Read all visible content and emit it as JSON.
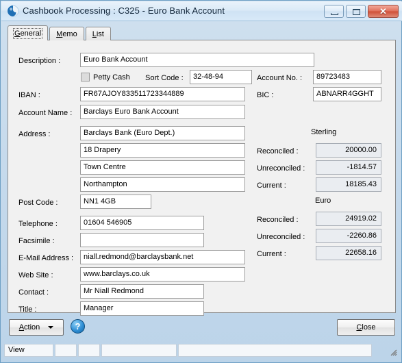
{
  "window": {
    "title": "Cashbook Processing : C325 - Euro Bank Account",
    "icon": "globe-icon",
    "controls": {
      "minimize": "minimize-icon",
      "maximize": "maximize-icon",
      "close": "✕"
    }
  },
  "tabs": [
    {
      "label": "General",
      "mnemonic": "G",
      "active": true
    },
    {
      "label": "Memo",
      "mnemonic": "M",
      "active": false
    },
    {
      "label": "List",
      "mnemonic": "L",
      "active": false
    }
  ],
  "form": {
    "description": {
      "label": "Description :",
      "value": "Euro Bank Account"
    },
    "petty_cash": {
      "label": "Petty Cash",
      "checked": false
    },
    "sort_code": {
      "label": "Sort Code :",
      "value": "32-48-94"
    },
    "account_no": {
      "label": "Account No. :",
      "value": "89723483"
    },
    "iban": {
      "label": "IBAN :",
      "value": "FR67AJOY833511723344889"
    },
    "bic": {
      "label": "BIC :",
      "value": "ABNARR4GGHT"
    },
    "account_name": {
      "label": "Account Name :",
      "value": "Barclays Euro Bank Account"
    },
    "address": {
      "label": "Address :",
      "lines": [
        "Barclays Bank (Euro Dept.)",
        "18 Drapery",
        "Town Centre",
        "Northampton"
      ]
    },
    "post_code": {
      "label": "Post Code :",
      "value": "NN1 4GB"
    },
    "telephone": {
      "label": "Telephone :",
      "value": "01604 546905"
    },
    "facsimile": {
      "label": "Facsimile :",
      "value": ""
    },
    "email": {
      "label": "E-Mail Address :",
      "value": "niall.redmond@barclaysbank.net"
    },
    "website": {
      "label": "Web Site :",
      "value": "www.barclays.co.uk"
    },
    "contact": {
      "label": "Contact :",
      "value": "Mr Niall Redmond"
    },
    "title_field": {
      "label": "Title :",
      "value": "Manager"
    }
  },
  "balances": {
    "sterling": {
      "heading": "Sterling",
      "reconciled_label": "Reconciled :",
      "reconciled": "20000.00",
      "unreconciled_label": "Unreconciled :",
      "unreconciled": "-1814.57",
      "current_label": "Current :",
      "current": "18185.43"
    },
    "euro": {
      "heading": "Euro",
      "reconciled_label": "Reconciled :",
      "reconciled": "24919.02",
      "unreconciled_label": "Unreconciled :",
      "unreconciled": "-2260.86",
      "current_label": "Current :",
      "current": "22658.16"
    }
  },
  "footer": {
    "action_label": "Action",
    "action_mnemonic": "A",
    "help_label": "?",
    "close_label": "Close",
    "close_mnemonic": "C"
  },
  "statusbar": {
    "panels": [
      "View",
      "",
      "",
      "",
      ""
    ]
  }
}
